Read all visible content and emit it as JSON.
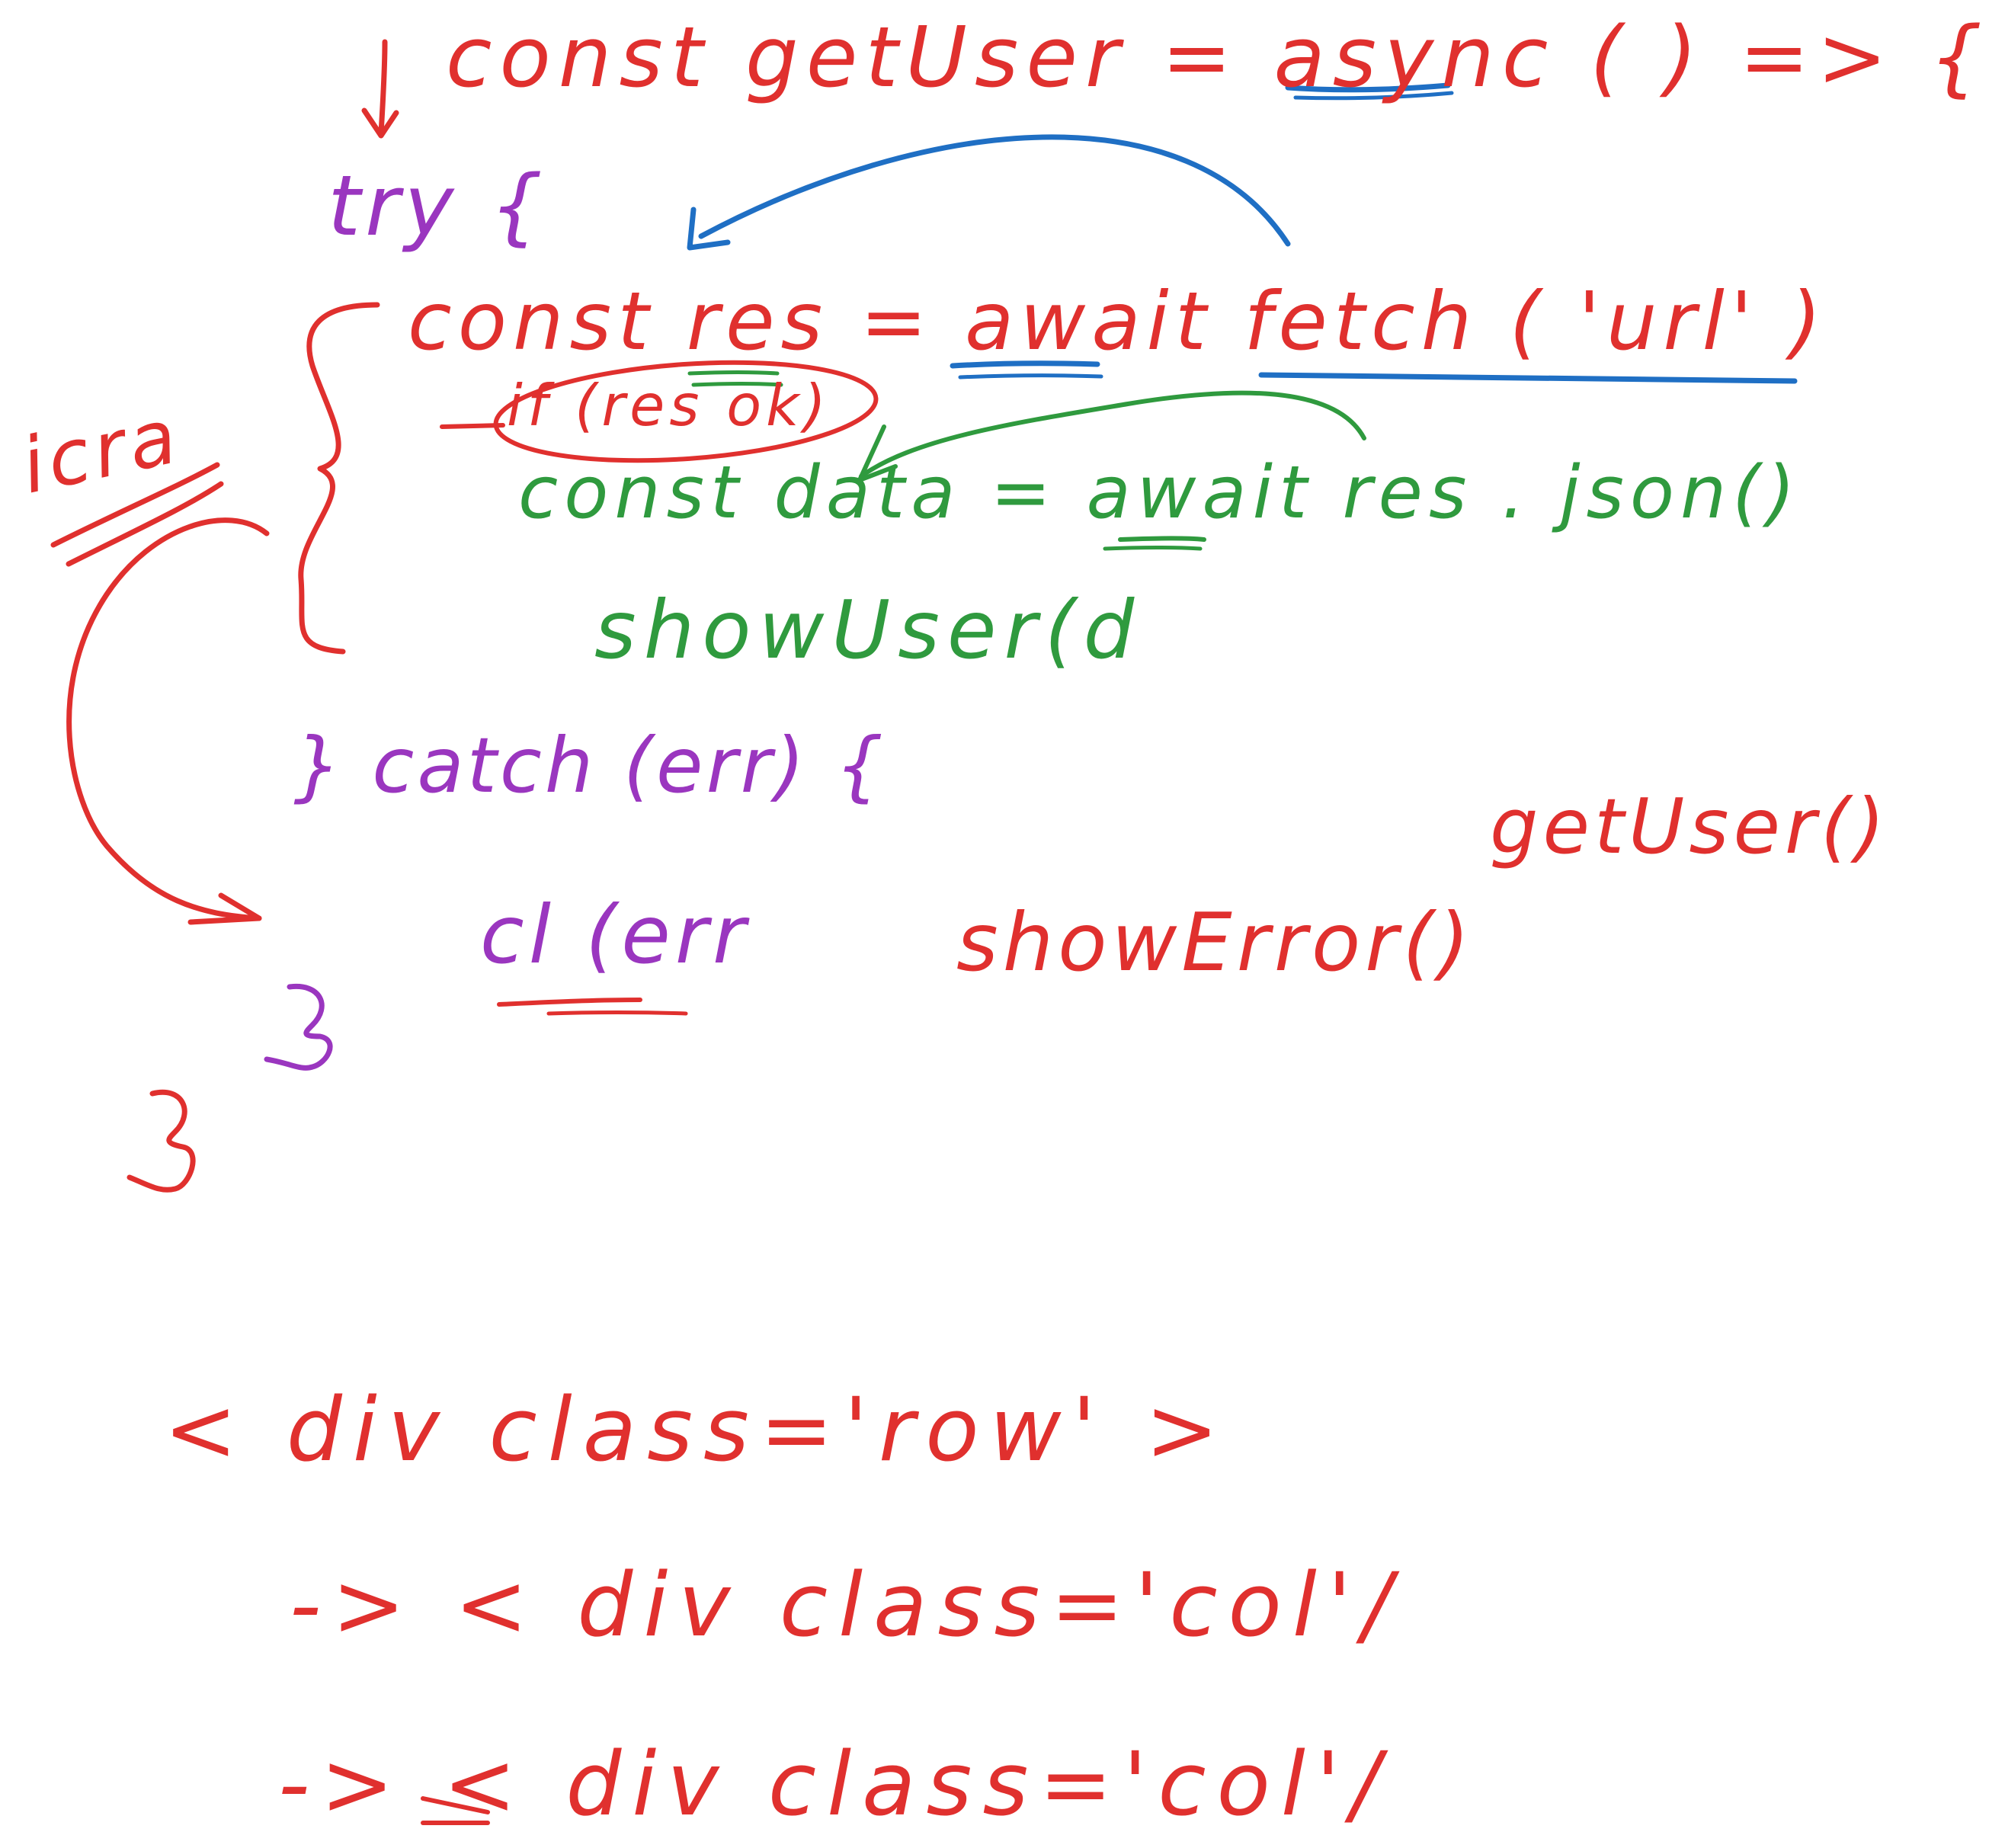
{
  "colors": {
    "red": "#e0302e",
    "purple": "#9a36bf",
    "green": "#2f9a3e",
    "blue": "#1f6fc4",
    "background": "#ffffff"
  },
  "code": {
    "line1": "const getUser = async ( ) => {",
    "line_try": "try {",
    "line_fetch": "const res = await fetch ( 'url' )",
    "line_if": "if (res ok)",
    "line_json": "const data = await res . json()",
    "line_show_user": "showUser(d",
    "line_catch": "} catch (err) {",
    "line_cl": "cl (err",
    "line_show_error": "showError()",
    "close_catch": "}",
    "close_fn": "}",
    "call": "getUser()"
  },
  "note": {
    "side_label": "icra"
  },
  "html": {
    "line1": "< div class='row' >",
    "line2": "-> < div class='col'/",
    "line3": "-> < div class='col'/"
  }
}
